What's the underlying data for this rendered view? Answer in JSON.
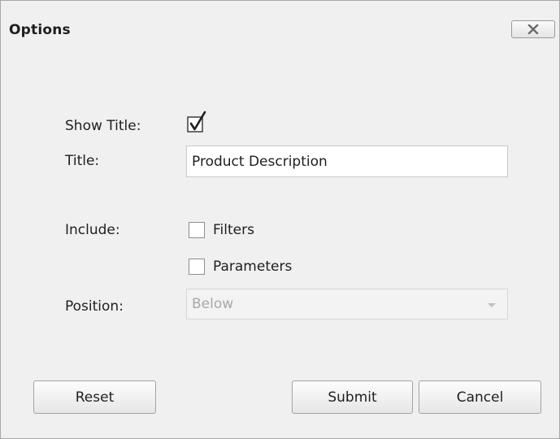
{
  "dialog": {
    "title": "Options",
    "close_icon": "close-x-icon"
  },
  "form": {
    "show_title": {
      "label": "Show Title:",
      "checked": true
    },
    "title": {
      "label": "Title:",
      "value": "Product Description"
    },
    "include": {
      "label": "Include:",
      "options": [
        {
          "label": "Filters",
          "checked": false
        },
        {
          "label": "Parameters",
          "checked": false
        }
      ]
    },
    "position": {
      "label": "Position:",
      "value": "Below",
      "disabled": true
    }
  },
  "buttons": {
    "reset": "Reset",
    "submit": "Submit",
    "cancel": "Cancel"
  },
  "colors": {
    "background": "#f0f0f0",
    "border": "#a7a7a7",
    "text": "#1e1e1e",
    "disabled_text": "#a9a9a9"
  }
}
